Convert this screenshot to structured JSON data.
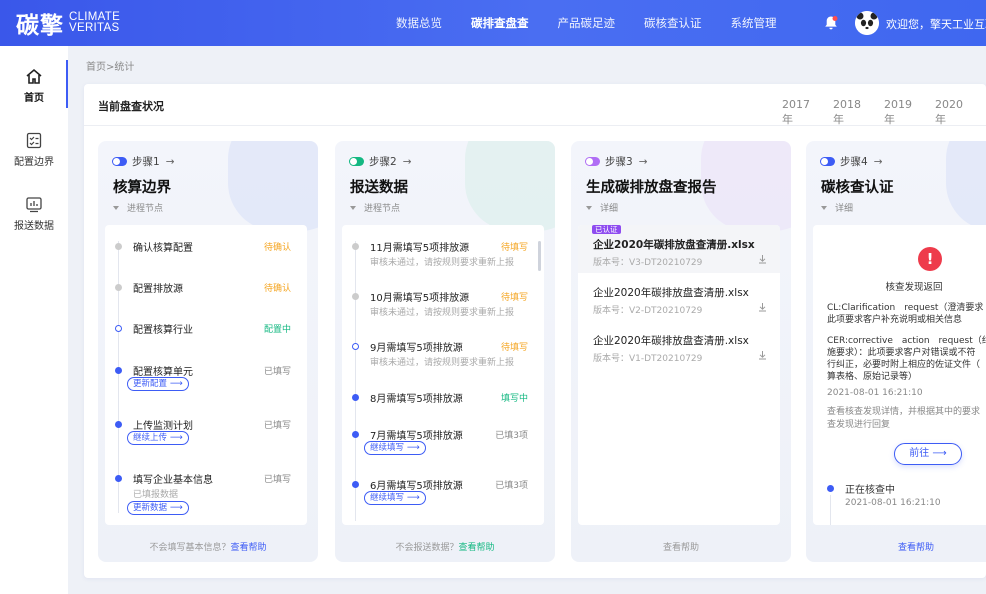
{
  "header": {
    "logo_cn": "碳擎",
    "logo_en_1": "CLIMATE",
    "logo_en_2": "VERITAS",
    "nav": [
      "数据总览",
      "碳排查盘查",
      "产品碳足迹",
      "碳核查认证",
      "系统管理"
    ],
    "active_nav": "碳排查盘查",
    "welcome": "欢迎您，擎天工业互联"
  },
  "sidebar": {
    "items": [
      {
        "label": "首页",
        "icon": "home-icon"
      },
      {
        "label": "配置边界",
        "icon": "checklist-icon"
      },
      {
        "label": "报送数据",
        "icon": "report-icon"
      }
    ]
  },
  "breadcrumb": "首页>统计",
  "panel": {
    "title": "当前盘查状况",
    "years": [
      "2017年",
      "2018年",
      "2019年",
      "2020年"
    ]
  },
  "cards": [
    {
      "step": "步骤1",
      "title": "核算边界",
      "sub": "进程节点",
      "items": [
        {
          "name": "确认核算配置",
          "status": "待确认"
        },
        {
          "name": "配置排放源",
          "status": "待确认"
        },
        {
          "name": "配置核算行业",
          "status": "配置中"
        },
        {
          "name": "配置核算单元",
          "status": "已填写",
          "button": "更新配置"
        },
        {
          "name": "上传监测计划",
          "status": "已填写",
          "button": "继续上传"
        },
        {
          "name": "填写企业基本信息",
          "status": "已填写",
          "desc": "已填报数据",
          "button": "更新数据"
        }
      ],
      "foot_text": "不会填写基本信息？",
      "foot_link": "查看帮助"
    },
    {
      "step": "步骤2",
      "title": "报送数据",
      "sub": "进程节点",
      "items": [
        {
          "name": "11月需填写5项排放源",
          "status": "待填写",
          "desc": "审核未通过，请按规则要求重新上报"
        },
        {
          "name": "10月需填写5项排放源",
          "status": "待填写",
          "desc": "审核未通过，请按规则要求重新上报"
        },
        {
          "name": "9月需填写5项排放源",
          "status": "待填写",
          "desc": "审核未通过，请按规则要求重新上报"
        },
        {
          "name": "8月需填写5项排放源",
          "status": "填写中"
        },
        {
          "name": "7月需填写5项排放源",
          "status": "已填3项",
          "button": "继续填写"
        },
        {
          "name": "6月需填写5项排放源",
          "status": "已填3项",
          "button": "继续填写"
        }
      ],
      "foot_text": "不会报送数据？",
      "foot_link": "查看帮助"
    },
    {
      "step": "步骤3",
      "title": "生成碳排放盘查报告",
      "sub": "详细",
      "files": [
        {
          "tag": "已认证",
          "name": "企业2020年碳排放盘查清册.xlsx",
          "version": "版本号：V3-DT20210729"
        },
        {
          "name": "企业2020年碳排放盘查清册.xlsx",
          "version": "版本号：V2-DT20210729"
        },
        {
          "name": "企业2020年碳排放盘查清册.xlsx",
          "version": "版本号：V1-DT20210729"
        }
      ],
      "foot_link": "查看帮助"
    },
    {
      "step": "步骤4",
      "title": "碳核查认证",
      "sub": "详细",
      "cert": {
        "heading": "核查发现返回",
        "cl_1": "CL:Clarification　request（澄清要求",
        "cl_2": "此项要求客户补充说明或相关信息",
        "cer_1": "CER:corrective　action　request（纠",
        "cer_2": "施要求）：此项要求客户对错误或不符",
        "cer_3": "行纠正，必要时附上相应的佐证文件（",
        "cer_4": "算表格、原始记录等）",
        "time": "2021-08-01 16:21:10",
        "note_1": "查看核查发现详情，并根据其中的要求",
        "note_2": "查发现进行回复",
        "button": "前往",
        "status": "正在核查中",
        "status_time": "2021-08-01 16:21:10"
      },
      "foot_link": "查看帮助"
    }
  ],
  "colors": {
    "accent": "#3d5cf5",
    "pending": "#f5a623",
    "active": "#14b882",
    "verified_tag": "#8e4cf0",
    "alert": "#ee3b4b"
  }
}
